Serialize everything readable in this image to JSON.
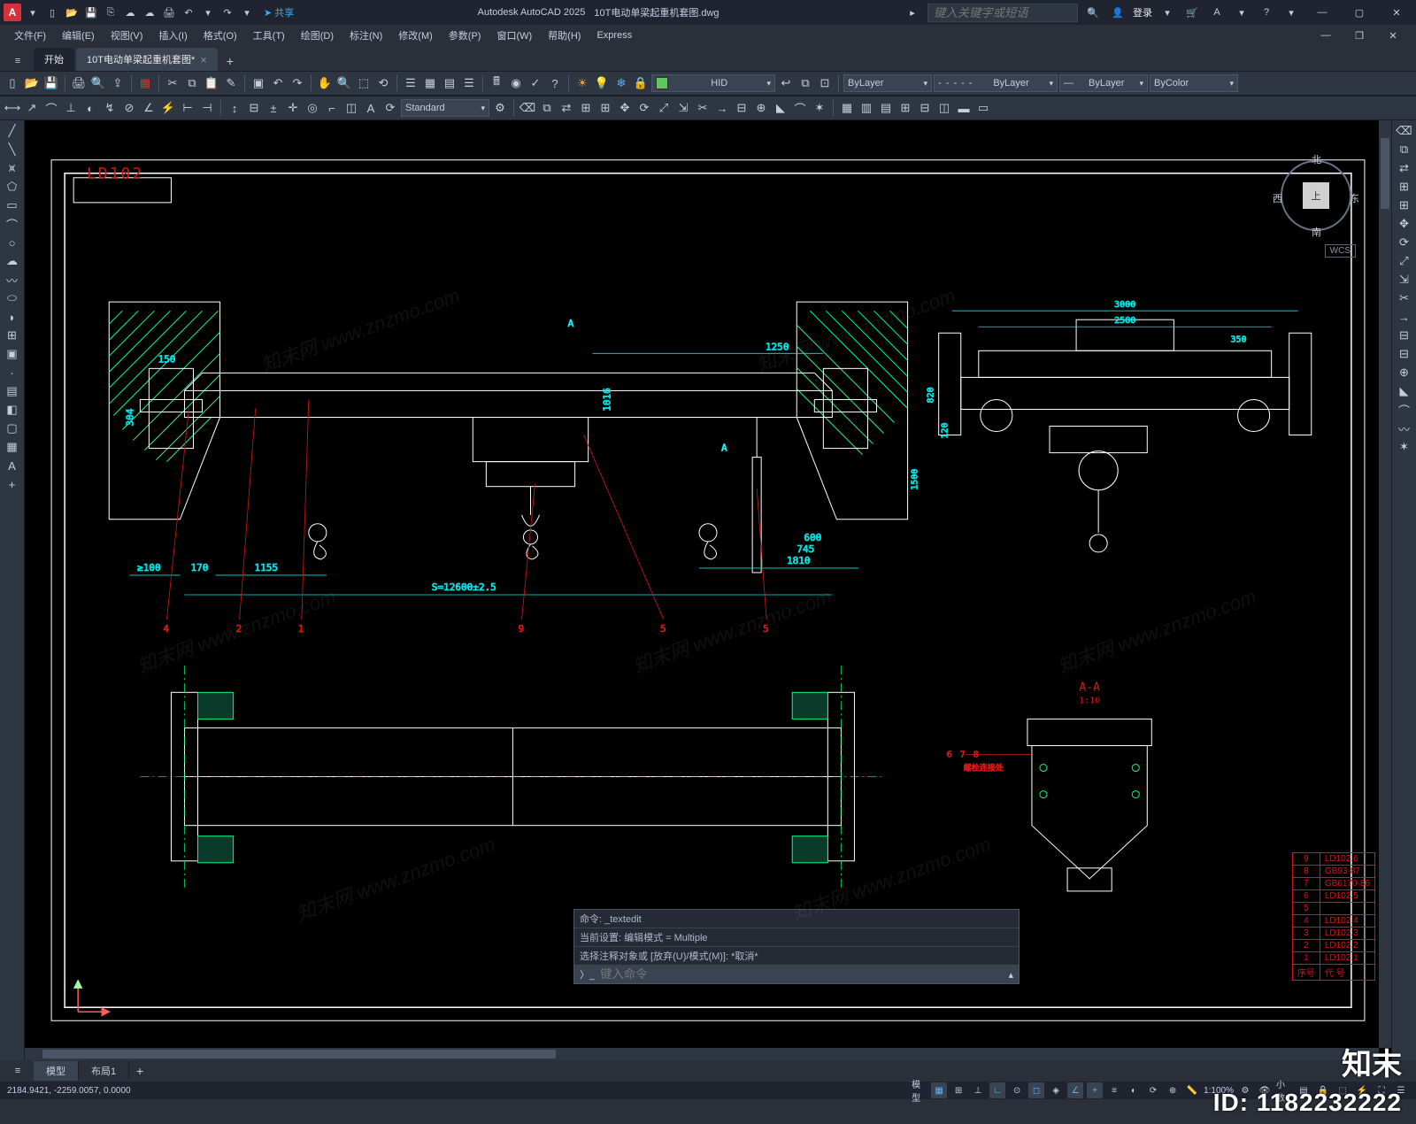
{
  "app": {
    "name": "Autodesk AutoCAD 2025",
    "document": "10T电动单梁起重机套图.dwg",
    "logo": "A"
  },
  "qat": {
    "share": "共享"
  },
  "search": {
    "placeholder": "键入关键字或短语"
  },
  "user": {
    "login": "登录"
  },
  "menubar": [
    "文件(F)",
    "编辑(E)",
    "视图(V)",
    "插入(I)",
    "格式(O)",
    "工具(T)",
    "绘图(D)",
    "标注(N)",
    "修改(M)",
    "参数(P)",
    "窗口(W)",
    "帮助(H)",
    "Express"
  ],
  "tabs": {
    "start": "开始",
    "doc": "10T电动单梁起重机套图*"
  },
  "layers": {
    "current": "HID",
    "lw": "ByLayer",
    "lt": "ByLayer",
    "lt2": "ByLayer",
    "color": "ByColor"
  },
  "textstyle": "Standard",
  "viewcube": {
    "face": "上",
    "n": "北",
    "s": "南",
    "e": "东",
    "w": "西",
    "wcs": "WCS"
  },
  "drawing": {
    "label": "LD102",
    "dims": {
      "span": "S=12600±2.5",
      "d1155": "1155",
      "d170": "170",
      "ge100": "≥100",
      "d1810": "1810",
      "d745": "745",
      "d600": "600",
      "d1250": "1250",
      "d150": "150",
      "d304": "304",
      "d1016": "1016",
      "d3000": "3000",
      "d2500": "2500",
      "d350": "350",
      "d120": "120",
      "d820": "820",
      "d1500": "1500",
      "sectAA": "A-A",
      "scale": "1:10",
      "a1": "A",
      "note1": "螺栓连接处"
    },
    "callouts": {
      "c1": "1",
      "c2": "2",
      "c4": "4",
      "c5": "5",
      "c6": "6",
      "c7": "7",
      "c8": "8",
      "c9": "9"
    },
    "parts": [
      {
        "n": "9",
        "code": "LD102.6"
      },
      {
        "n": "8",
        "code": "GB93-87"
      },
      {
        "n": "7",
        "code": "GB6170-86"
      },
      {
        "n": "6",
        "code": "LD102.5"
      },
      {
        "n": "5",
        "code": ""
      },
      {
        "n": "4",
        "code": "LD102.4"
      },
      {
        "n": "3",
        "code": "LD102.3"
      },
      {
        "n": "2",
        "code": "LD102.2"
      },
      {
        "n": "1",
        "code": "LD102.1"
      }
    ],
    "parts_header": {
      "n": "序号",
      "code": "代  号"
    }
  },
  "cmd": {
    "h1": "命令: _textedit",
    "h2": "当前设置: 编辑模式 = Multiple",
    "h3": "选择注释对象或 [放弃(U)/模式(M)]: *取消*",
    "prompt": "键入命令"
  },
  "bottom_tabs": {
    "model": "模型",
    "layout1": "布局1"
  },
  "status": {
    "coords": "2184.9421, -2259.0057, 0.0000",
    "ps": "模型",
    "grid": "# :::",
    "scale": "1:100%",
    "decimal": "小数"
  },
  "watermark": {
    "brand": "知末",
    "id": "ID: 1182232222",
    "diag": "知末网 www.znzmo.com"
  }
}
